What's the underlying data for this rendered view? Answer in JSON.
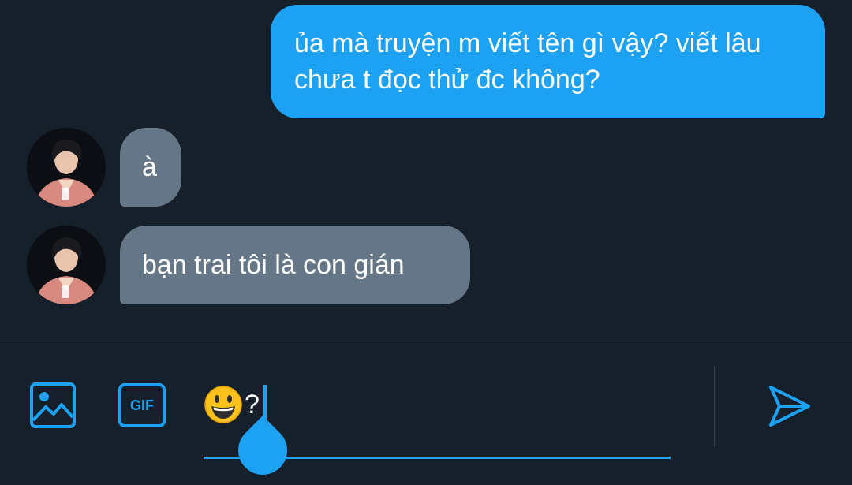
{
  "messages": [
    {
      "from": "me",
      "text": "ủa mà truyện m viết tên gì vậy? viết lâu chưa t đọc thử đc không?"
    },
    {
      "from": "them",
      "text": "à"
    },
    {
      "from": "them",
      "text": "bạn trai tôi là con gián"
    }
  ],
  "composer": {
    "gif_label": "GIF",
    "emoji": "smiling-face-emoji",
    "typed_text": "?",
    "accent_color": "#1da1f2"
  },
  "colors": {
    "background": "#15202b",
    "outgoing_bubble": "#1da1f2",
    "incoming_bubble": "#657786",
    "divider": "#38444d"
  }
}
